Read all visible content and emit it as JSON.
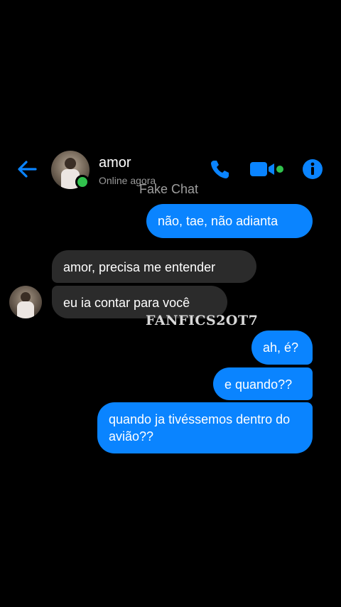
{
  "header": {
    "contact_name": "amor",
    "status": "Online agora",
    "watermark": "Fake Chat",
    "icons": {
      "back": "back-arrow-icon",
      "call": "phone-icon",
      "video": "video-call-icon",
      "info": "info-icon"
    }
  },
  "colors": {
    "accent": "#0a84ff",
    "incoming_bubble": "#2b2b2b",
    "online": "#31c24d"
  },
  "messages": [
    {
      "sender": "me",
      "text": "não, tae, não adianta"
    },
    {
      "sender": "contact",
      "text": "amor, precisa me entender"
    },
    {
      "sender": "contact",
      "text": "eu ia contar para você"
    },
    {
      "sender": "me",
      "text": "ah, é?"
    },
    {
      "sender": "me",
      "text": "e quando??"
    },
    {
      "sender": "me",
      "text": "quando ja tivéssemos dentro do avião??"
    }
  ],
  "watermark_mid": "FANFICS2OT7"
}
